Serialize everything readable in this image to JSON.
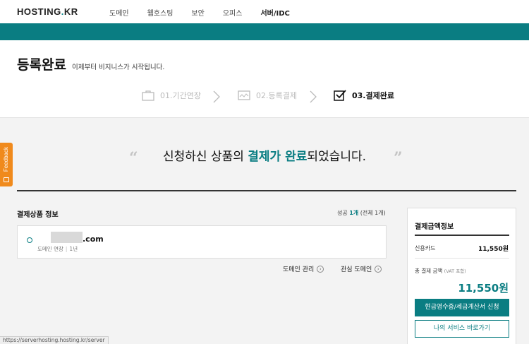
{
  "nav": {
    "logo_main": "HOSTING",
    "logo_dot": ".",
    "logo_tld": "KR",
    "items": [
      "도메인",
      "웹호스팅",
      "보안",
      "오피스",
      "서버/IDC"
    ]
  },
  "header": {
    "title": "등록완료",
    "subtitle": "이제부터 비지니스가 시작됩니다."
  },
  "steps": [
    {
      "label": "01.기간연장",
      "icon": "bag-icon"
    },
    {
      "label": "02.등록결제",
      "icon": "card-icon"
    },
    {
      "label": "03.결제완료",
      "icon": "check-box-icon"
    }
  ],
  "feedback_label": "Feedback",
  "message": {
    "pre": "신청하신 상품의 ",
    "highlight": "결제가 완료",
    "post": "되었습니다."
  },
  "order": {
    "title": "결제상품 정보",
    "count_label": "성공",
    "success": "1개",
    "total": "(전체 1개)",
    "item": {
      "domain_suffix": ".com",
      "type": "도메인 연장",
      "period": "1년"
    },
    "links": [
      "도메인 관리",
      "관심 도메인"
    ]
  },
  "payment": {
    "title": "결제금액정보",
    "method": "신용카드",
    "method_amount": "11,550원",
    "total_label": "총 결제 금액",
    "vat_note": "(VAT 포함)",
    "total_amount": "11,550원",
    "btn_receipt": "현금영수증/세금계산서 신청",
    "btn_services": "나의 서비스 바로가기"
  },
  "status_url": "https://serverhosting.hosting.kr/server",
  "colors": {
    "accent": "#0a7d82",
    "feedback": "#f08a1c"
  }
}
